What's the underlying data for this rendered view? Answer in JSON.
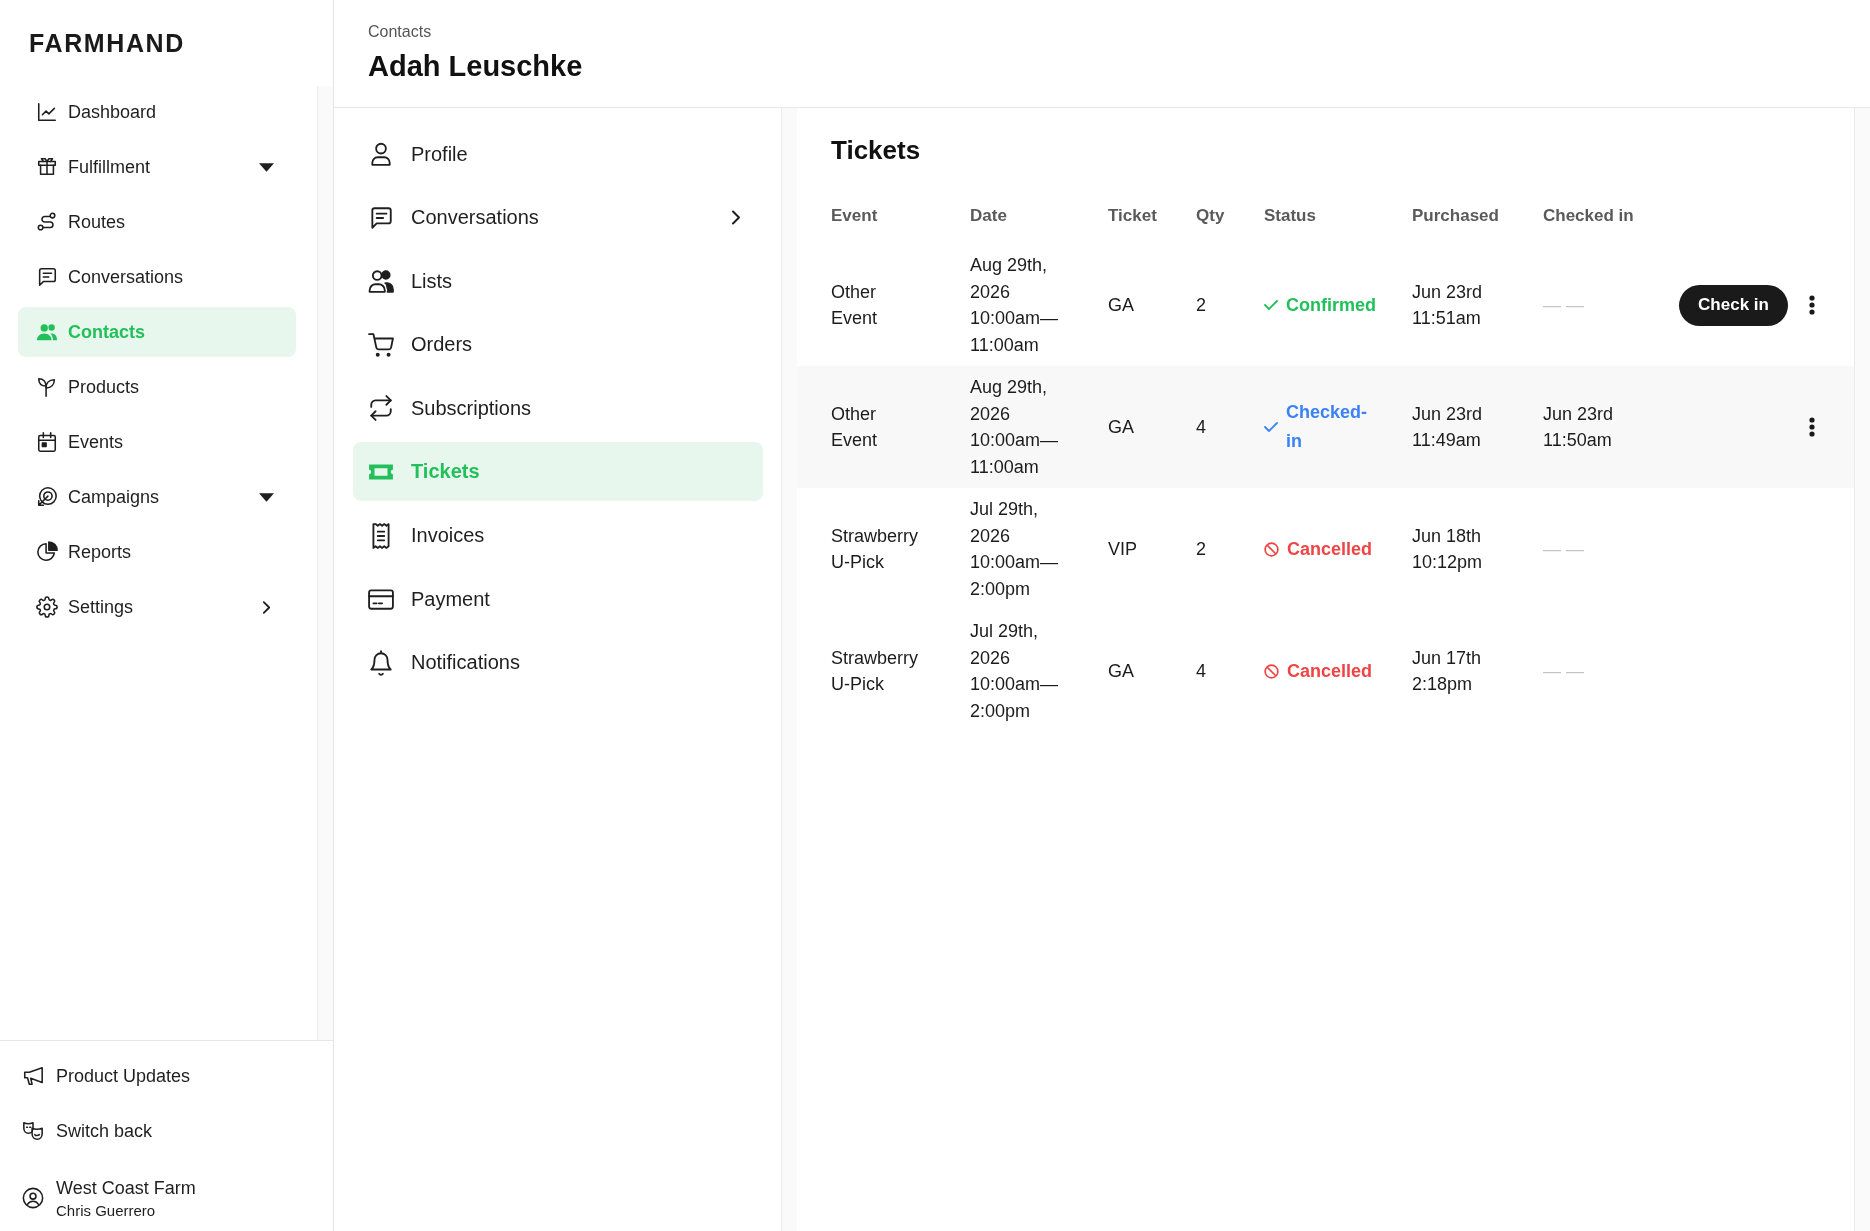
{
  "sidebar": {
    "brand": "FARMHAND",
    "items": [
      {
        "label": "Dashboard",
        "kind": "link",
        "selected": false
      },
      {
        "label": "Fulfillment",
        "kind": "dropdown",
        "selected": false
      },
      {
        "label": "Routes",
        "kind": "link",
        "selected": false
      },
      {
        "label": "Conversations",
        "kind": "link",
        "selected": false
      },
      {
        "label": "Contacts",
        "kind": "link",
        "selected": true
      },
      {
        "label": "Products",
        "kind": "link",
        "selected": false
      },
      {
        "label": "Events",
        "kind": "link",
        "selected": false
      },
      {
        "label": "Campaigns",
        "kind": "dropdown",
        "selected": false
      },
      {
        "label": "Reports",
        "kind": "link",
        "selected": false
      },
      {
        "label": "Settings",
        "kind": "submenu",
        "selected": false
      }
    ],
    "footer": {
      "links": [
        "Product Updates",
        "Switch back"
      ],
      "account": {
        "name": "West Coast Farm",
        "user": "Chris Guerrero"
      }
    }
  },
  "header": {
    "breadcrumb": "Contacts",
    "title": "Adah Leuschke"
  },
  "contact_nav": {
    "items": [
      {
        "label": "Profile",
        "kind": "link",
        "selected": false
      },
      {
        "label": "Conversations",
        "kind": "submenu",
        "selected": false
      },
      {
        "label": "Lists",
        "kind": "link",
        "selected": false
      },
      {
        "label": "Orders",
        "kind": "link",
        "selected": false
      },
      {
        "label": "Subscriptions",
        "kind": "link",
        "selected": false
      },
      {
        "label": "Tickets",
        "kind": "link",
        "selected": true
      },
      {
        "label": "Invoices",
        "kind": "link",
        "selected": false
      },
      {
        "label": "Payment",
        "kind": "link",
        "selected": false
      },
      {
        "label": "Notifications",
        "kind": "link",
        "selected": false
      }
    ]
  },
  "tickets": {
    "title": "Tickets",
    "columns": [
      "Event",
      "Date",
      "Ticket",
      "Qty",
      "Status",
      "Purchased",
      "Checked in"
    ],
    "rows": [
      {
        "event": "Other Event",
        "date": "Aug 29th, 2026 10:00am—11:00am",
        "ticket": "GA",
        "qty": "2",
        "status": {
          "label": "Confirmed",
          "kind": "confirmed"
        },
        "purchased": "Jun 23rd 11:51am",
        "checked_in_placeholder": "——",
        "action": "Check in",
        "menu": true,
        "highlighted": false
      },
      {
        "event": "Other Event",
        "date": "Aug 29th, 2026 10:00am—11:00am",
        "ticket": "GA",
        "qty": "4",
        "status": {
          "label": "Checked-in",
          "kind": "checked_in"
        },
        "purchased": "Jun 23rd 11:49am",
        "checked_in": "Jun 23rd 11:50am",
        "menu": true,
        "highlighted": true
      },
      {
        "event": "Strawberry U-Pick",
        "date": "Jul 29th, 2026 10:00am—2:00pm",
        "ticket": "VIP",
        "qty": "2",
        "status": {
          "label": "Cancelled",
          "kind": "cancelled"
        },
        "purchased": "Jun 18th 10:12pm",
        "checked_in_placeholder": "——",
        "menu": false,
        "highlighted": false
      },
      {
        "event": "Strawberry U-Pick",
        "date": "Jul 29th, 2026 10:00am—2:00pm",
        "ticket": "GA",
        "qty": "4",
        "status": {
          "label": "Cancelled",
          "kind": "cancelled"
        },
        "purchased": "Jun 17th 2:18pm",
        "checked_in_placeholder": "——",
        "menu": false,
        "highlighted": false
      }
    ]
  }
}
